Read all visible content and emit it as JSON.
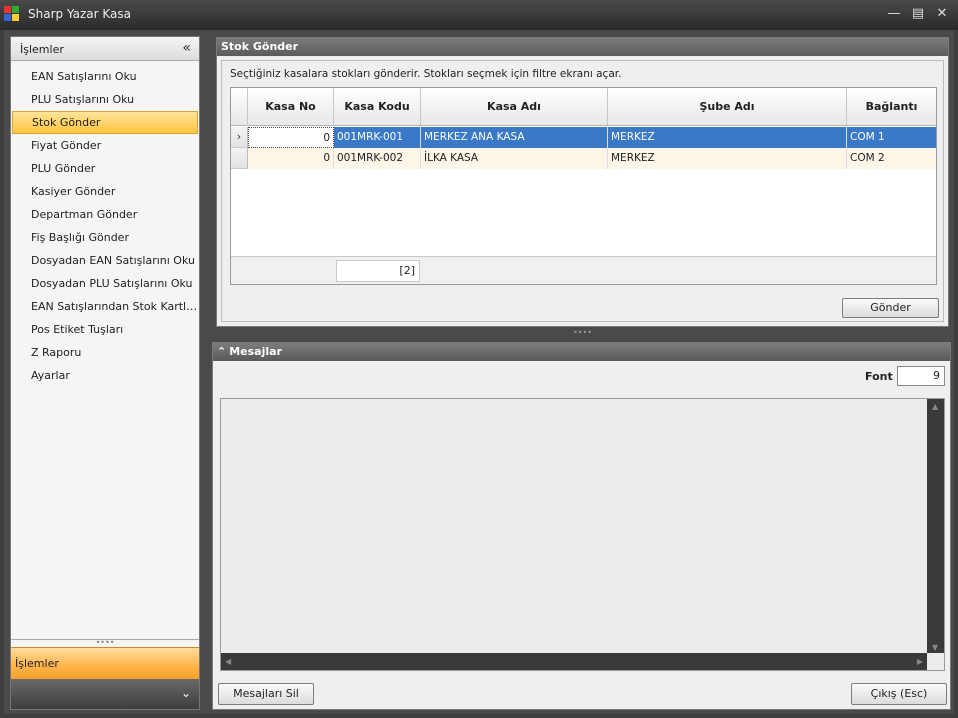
{
  "window": {
    "title": "Sharp Yazar Kasa"
  },
  "nav": {
    "header": "İşlemler",
    "items": [
      "EAN Satışlarını Oku",
      "PLU Satışlarını Oku",
      "Stok Gönder",
      "Fiyat Gönder",
      "PLU Gönder",
      "Kasiyer Gönder",
      "Departman Gönder",
      "Fiş Başlığı Gönder",
      "Dosyadan EAN Satışlarını Oku",
      "Dosyadan PLU Satışlarını Oku",
      "EAN Satışlarından Stok Kartları...",
      "Pos Etiket Tuşları",
      "Z Raporu",
      "Ayarlar"
    ],
    "selected": "Stok Gönder",
    "group_label": "İşlemler"
  },
  "stok": {
    "title": "Stok Gönder",
    "description": "Seçtiğiniz kasalara stokları gönderir. Stokları seçmek için filtre ekranı açar.",
    "columns": [
      "Kasa No",
      "Kasa Kodu",
      "Kasa Adı",
      "Şube Adı",
      "Bağlantı"
    ],
    "rows": [
      {
        "kasa_no": "0",
        "kasa_kodu": "001MRK-001",
        "kasa_adi": "MERKEZ ANA KASA",
        "sube_adi": "MERKEZ",
        "baglanti": "COM 1"
      },
      {
        "kasa_no": "0",
        "kasa_kodu": "001MRK-002",
        "kasa_adi": "İLKA KASA",
        "sube_adi": "MERKEZ",
        "baglanti": "COM 2"
      }
    ],
    "footer_count": "[2]",
    "send_button": "Gönder"
  },
  "messages": {
    "title": "Mesajlar",
    "font_label": "Font",
    "font_value": "9",
    "clear_button": "Mesajları Sil",
    "exit_button": "Çıkış (Esc)"
  }
}
